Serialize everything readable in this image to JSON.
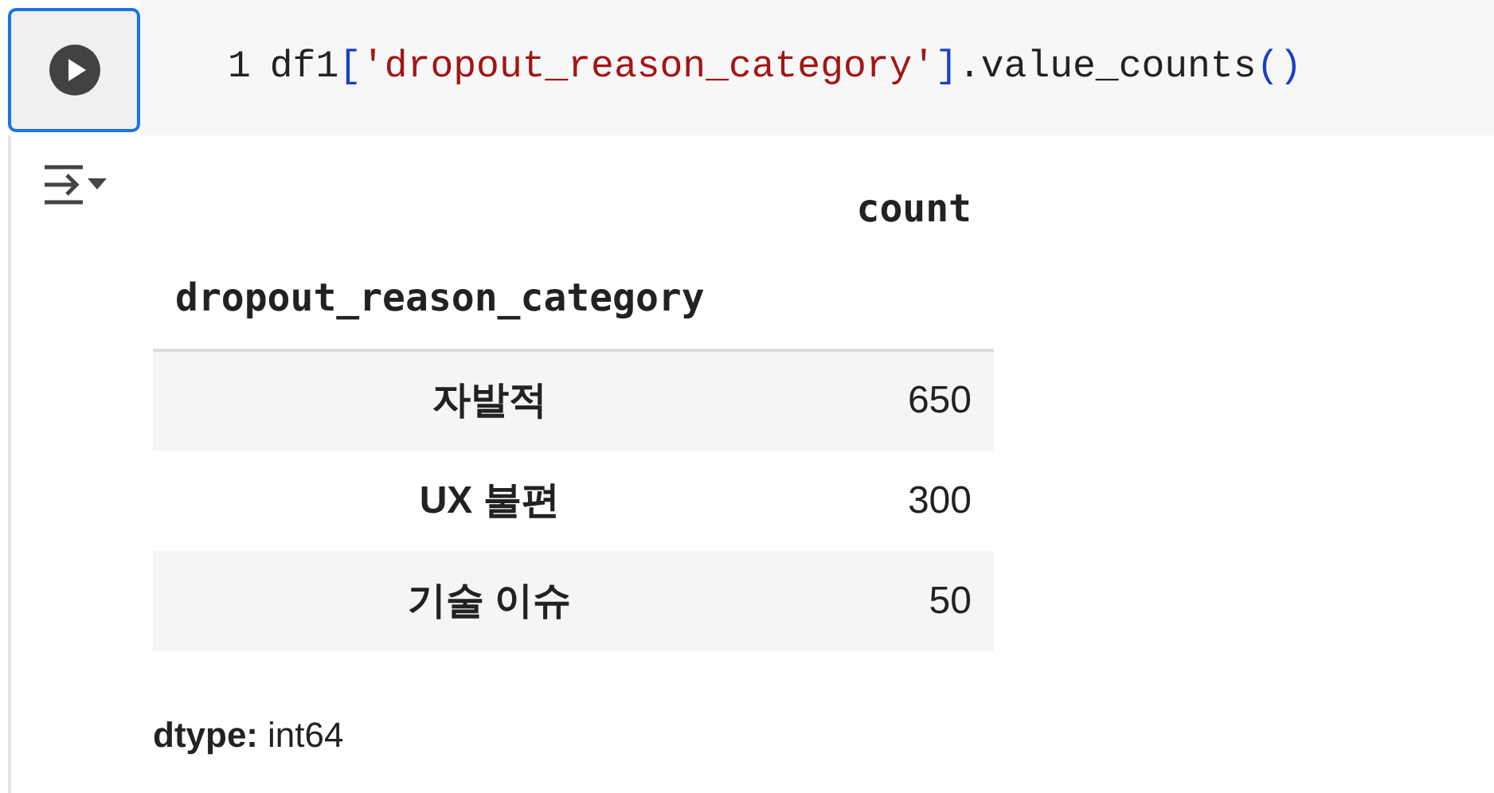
{
  "code_cell": {
    "line_number": "1",
    "tokens": [
      {
        "text": "df1",
        "kind": "plain"
      },
      {
        "text": "[",
        "kind": "bracket"
      },
      {
        "text": "'dropout_reason_category'",
        "kind": "string"
      },
      {
        "text": "]",
        "kind": "bracket"
      },
      {
        "text": ".value_counts",
        "kind": "plain"
      },
      {
        "text": "()",
        "kind": "bracket"
      }
    ]
  },
  "output": {
    "table": {
      "value_column": "count",
      "index_name": "dropout_reason_category",
      "rows": [
        {
          "label": "자발적",
          "count": "650"
        },
        {
          "label": "UX 불편",
          "count": "300"
        },
        {
          "label": "기술 이슈",
          "count": "50"
        }
      ]
    },
    "dtype_label": "dtype:",
    "dtype_value": "int64"
  }
}
